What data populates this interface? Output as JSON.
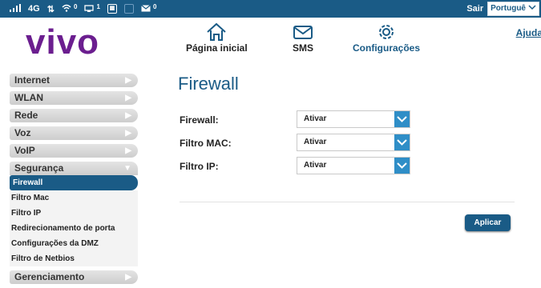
{
  "status_bar": {
    "signal_icon": "signal-bars-icon",
    "network": "4G",
    "data_icon": "data-arrows-icon",
    "wifi_count": "0",
    "devices_count": "1",
    "sim_icon": "sim-icon",
    "messages_count": "0"
  },
  "top_right": {
    "exit_label": "Sair",
    "language": "Portuguê"
  },
  "logo": {
    "text": "vivo",
    "color": "#6b1e8f"
  },
  "nav": {
    "home": "Página inicial",
    "sms": "SMS",
    "settings": "Configurações",
    "help": "Ajuda"
  },
  "sidebar": {
    "items": [
      {
        "label": "Internet"
      },
      {
        "label": "WLAN"
      },
      {
        "label": "Rede"
      },
      {
        "label": "Voz"
      },
      {
        "label": "VoIP"
      },
      {
        "label": "Segurança"
      },
      {
        "label": "Gerenciamento"
      }
    ],
    "security_sub": [
      {
        "label": "Firewall"
      },
      {
        "label": "Filtro Mac"
      },
      {
        "label": "Filtro IP"
      },
      {
        "label": "Redirecionamento de porta"
      },
      {
        "label": "Configurações da DMZ"
      },
      {
        "label": "Filtro de Netbios"
      }
    ]
  },
  "main": {
    "title": "Firewall",
    "fields": [
      {
        "label": "Firewall:",
        "value": "Ativar"
      },
      {
        "label": "Filtro MAC:",
        "value": "Ativar"
      },
      {
        "label": "Filtro IP:",
        "value": "Ativar"
      }
    ],
    "apply_label": "Aplicar"
  },
  "colors": {
    "accent": "#1a5b86",
    "dropdown": "#2f8ec7"
  }
}
